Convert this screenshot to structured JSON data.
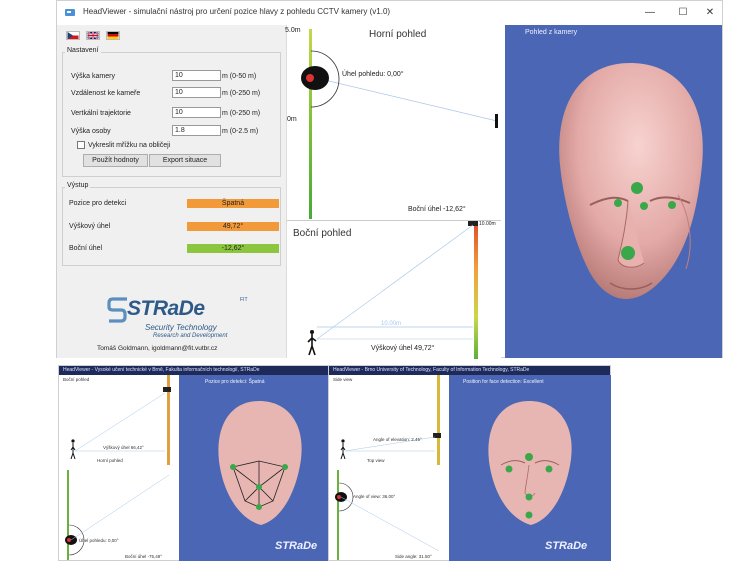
{
  "window": {
    "title": "HeadViewer - simulační nástroj pro určení pozice hlavy z pohledu CCTV kamery (v1.0)",
    "controls": {
      "minimize": "—",
      "maximize": "☐",
      "close": "✕"
    }
  },
  "languages": [
    "cs",
    "en",
    "de"
  ],
  "settings": {
    "group_title": "Nastavení",
    "fields": [
      {
        "label": "Výška kamery",
        "value": "10",
        "unit": "m (0-50 m)"
      },
      {
        "label": "Vzdálenost ke kameře",
        "value": "10",
        "unit": "m (0-250 m)"
      },
      {
        "label": "Vertkální trajektorie",
        "value": "10",
        "unit": "m (0-250 m)"
      },
      {
        "label": "Výška osoby",
        "value": "1.8",
        "unit": "m (0-2.5 m)"
      }
    ],
    "checkbox_label": "Vykreslit mřížku na obličeji",
    "apply_button": "Použít hodnoty",
    "export_button": "Export situace"
  },
  "output": {
    "group_title": "Výstup",
    "rows": [
      {
        "label": "Pozice pro detekci",
        "value": "Špatná",
        "color": "#f29a3a"
      },
      {
        "label": "Výškový úhel",
        "value": "49,72°",
        "color": "#f29a3a"
      },
      {
        "label": "Boční úhel",
        "value": "-12,62°",
        "color": "#8cc63f"
      }
    ]
  },
  "logo": {
    "name": "STRaDe",
    "superscript": "FIT",
    "line1": "Security Technology",
    "line2": "Research and Development",
    "credit": "Tomáš Goldmann, igoldmann@fit.vutbr.cz"
  },
  "top_view": {
    "title": "Horní pohled",
    "axis_top": "5.0m",
    "axis_mid": "0m",
    "view_angle": "Úhel pohledu: 0,00°",
    "side_angle": "Boční úhel  -12,62°"
  },
  "side_view": {
    "title": "Boční pohled",
    "axis_top": "10.00m",
    "distance": "10.00m",
    "vertical_angle": "Výškový úhel 49,72°"
  },
  "camera_view": {
    "title": "Pohled z kamery",
    "bg": "#4a66b4",
    "skin": "#e9b6b3",
    "marker": "#3aa84a"
  },
  "screenshot_cz": {
    "title": "HeadViewer - Vysoké učení technické v Brně, Fakulta informačních technologií, STRaDe",
    "side_title": "Boční pohled",
    "top_title": "Horní pohled",
    "status": "Pozice pro detekci: Špatná",
    "vertical_angle": "Výškový úhel 66,42°",
    "view_angle": "Úhel pohledu: 0,00°",
    "side_angle": "Boční úhel -75,49°",
    "logo": "STRaDe"
  },
  "screenshot_en": {
    "title": "HeadViewer - Brno University of Technology, Faculty of Information Technology, STRaDe",
    "side_title": "Side view",
    "top_title": "Top view",
    "status": "Position for face detection: Excellent",
    "vertical_angle": "Angle of elevation: 2.45°",
    "view_angle": "Angle of view: 36.00°",
    "side_angle": "Side angle: 31.50°",
    "logo": "STRaDe"
  }
}
